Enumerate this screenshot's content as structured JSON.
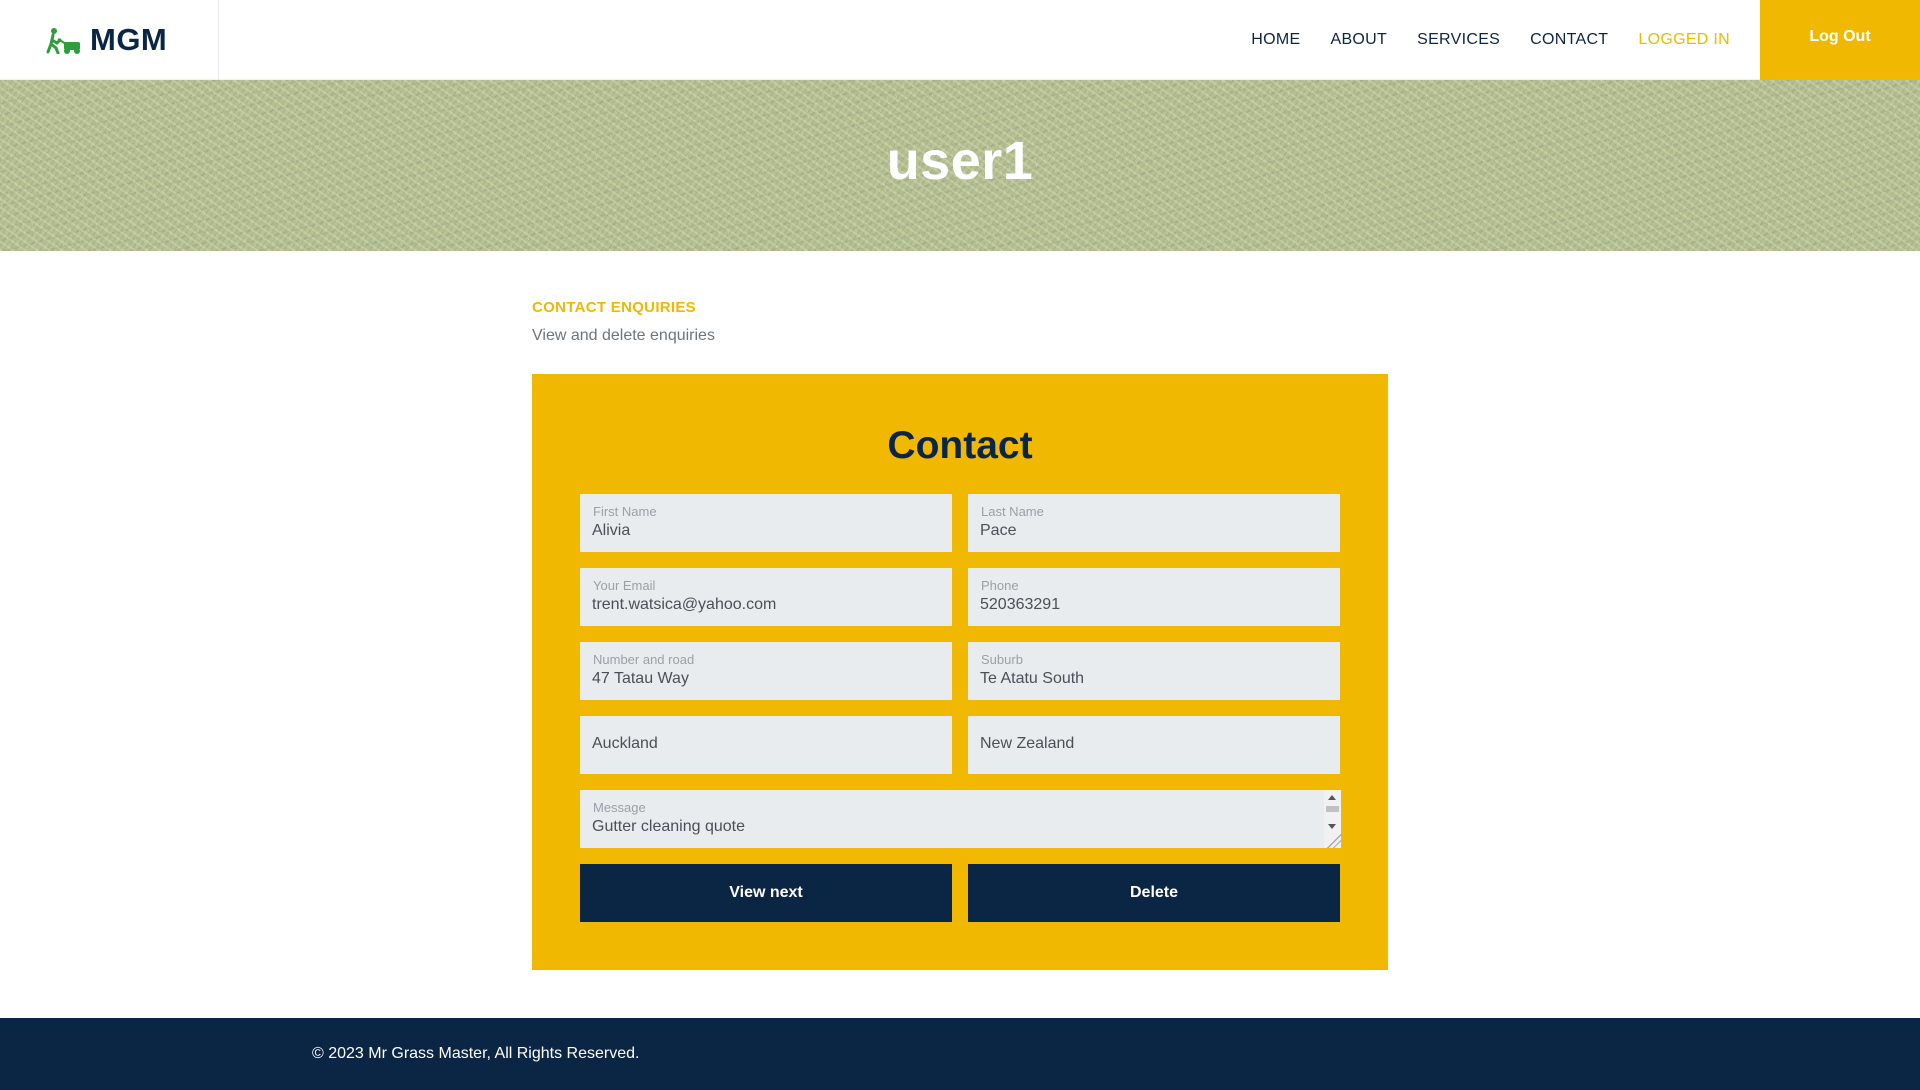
{
  "brand": {
    "name": "MGM",
    "icon": "lawnmower-icon"
  },
  "nav": {
    "items": [
      {
        "label": "HOME"
      },
      {
        "label": "ABOUT"
      },
      {
        "label": "SERVICES"
      },
      {
        "label": "CONTACT"
      },
      {
        "label": "LOGGED IN"
      }
    ],
    "logout_label": "Log Out"
  },
  "hero": {
    "title": "user1"
  },
  "section": {
    "label": "CONTACT ENQUIRIES",
    "subtitle": "View and delete enquiries"
  },
  "form": {
    "title": "Contact",
    "first_name": {
      "label": "First Name",
      "value": "Alivia"
    },
    "last_name": {
      "label": "Last Name",
      "value": "Pace"
    },
    "email": {
      "label": "Your Email",
      "value": "trent.watsica@yahoo.com"
    },
    "phone": {
      "label": "Phone",
      "value": "520363291"
    },
    "road": {
      "label": "Number and road",
      "value": "47 Tatau Way"
    },
    "suburb": {
      "label": "Suburb",
      "value": "Te Atatu South"
    },
    "city": {
      "value": "Auckland"
    },
    "country": {
      "value": "New Zealand"
    },
    "message": {
      "label": "Message",
      "value": "Gutter cleaning quote"
    },
    "view_next_label": "View next",
    "delete_label": "Delete"
  },
  "footer": {
    "text": "© 2023 Mr Grass Master, All Rights Reserved."
  },
  "colors": {
    "accent": "#f0b800",
    "navy": "#0b2545",
    "field": "#e9ecef"
  }
}
